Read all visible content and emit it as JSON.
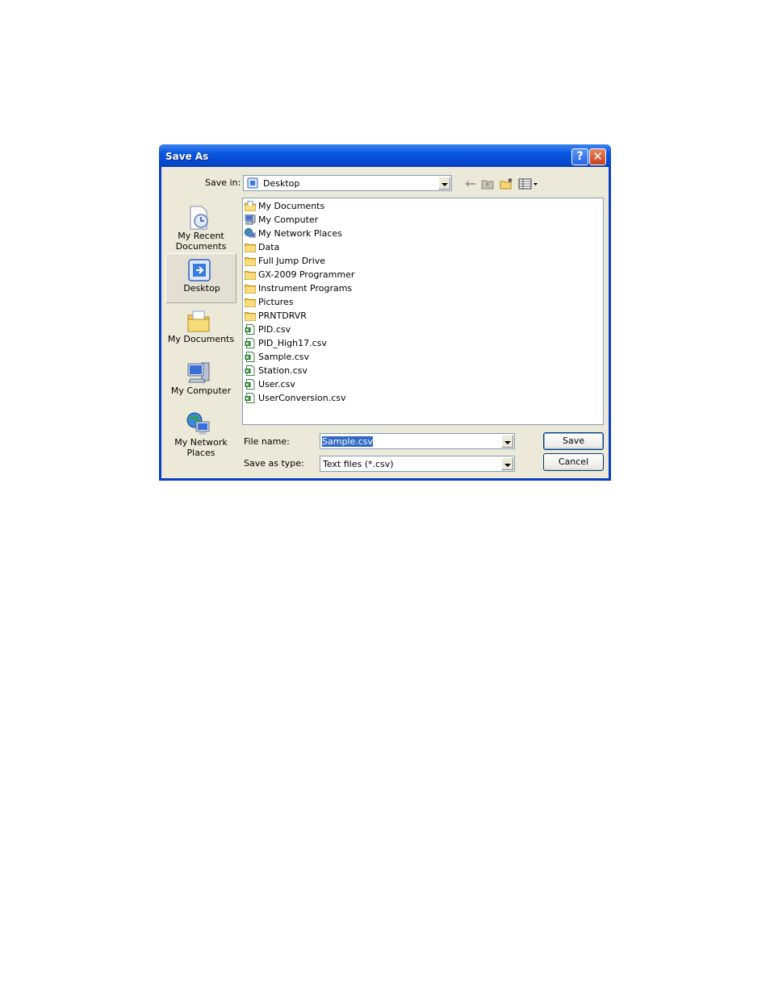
{
  "window": {
    "title": "Save As",
    "help_glyph": "?",
    "close_glyph": "✕"
  },
  "toolbar": {
    "save_in_label": "Save in:",
    "save_in_value": "Desktop",
    "icons": [
      "back-icon",
      "up-folder-icon",
      "new-folder-icon",
      "views-menu-icon"
    ]
  },
  "places": [
    {
      "label": "My Recent Documents",
      "icon": "recent-documents-icon"
    },
    {
      "label": "Desktop",
      "icon": "desktop-icon",
      "selected": true
    },
    {
      "label": "My Documents",
      "icon": "my-documents-icon"
    },
    {
      "label": "My Computer",
      "icon": "my-computer-icon"
    },
    {
      "label": "My Network Places",
      "icon": "network-places-icon"
    }
  ],
  "files": [
    {
      "name": "My Documents",
      "type": "mydocs"
    },
    {
      "name": "My Computer",
      "type": "computer"
    },
    {
      "name": "My Network Places",
      "type": "network"
    },
    {
      "name": "Data",
      "type": "folder"
    },
    {
      "name": "Full Jump Drive",
      "type": "folder"
    },
    {
      "name": "GX-2009 Programmer",
      "type": "folder"
    },
    {
      "name": "Instrument Programs",
      "type": "folder"
    },
    {
      "name": "Pictures",
      "type": "folder"
    },
    {
      "name": "PRNTDRVR",
      "type": "folder"
    },
    {
      "name": "PID.csv",
      "type": "csv"
    },
    {
      "name": "PID_High17.csv",
      "type": "csv"
    },
    {
      "name": "Sample.csv",
      "type": "csv"
    },
    {
      "name": "Station.csv",
      "type": "csv"
    },
    {
      "name": "User.csv",
      "type": "csv"
    },
    {
      "name": "UserConversion.csv",
      "type": "csv"
    }
  ],
  "form": {
    "file_name_label": "File name:",
    "file_name_value": "Sample.csv",
    "save_type_label": "Save as type:",
    "save_type_value": "Text files (*.csv)"
  },
  "buttons": {
    "save": "Save",
    "cancel": "Cancel"
  },
  "colors": {
    "title_bar": "#0a57e0",
    "dialog_face": "#ece9d8",
    "selection": "#316ac5"
  }
}
